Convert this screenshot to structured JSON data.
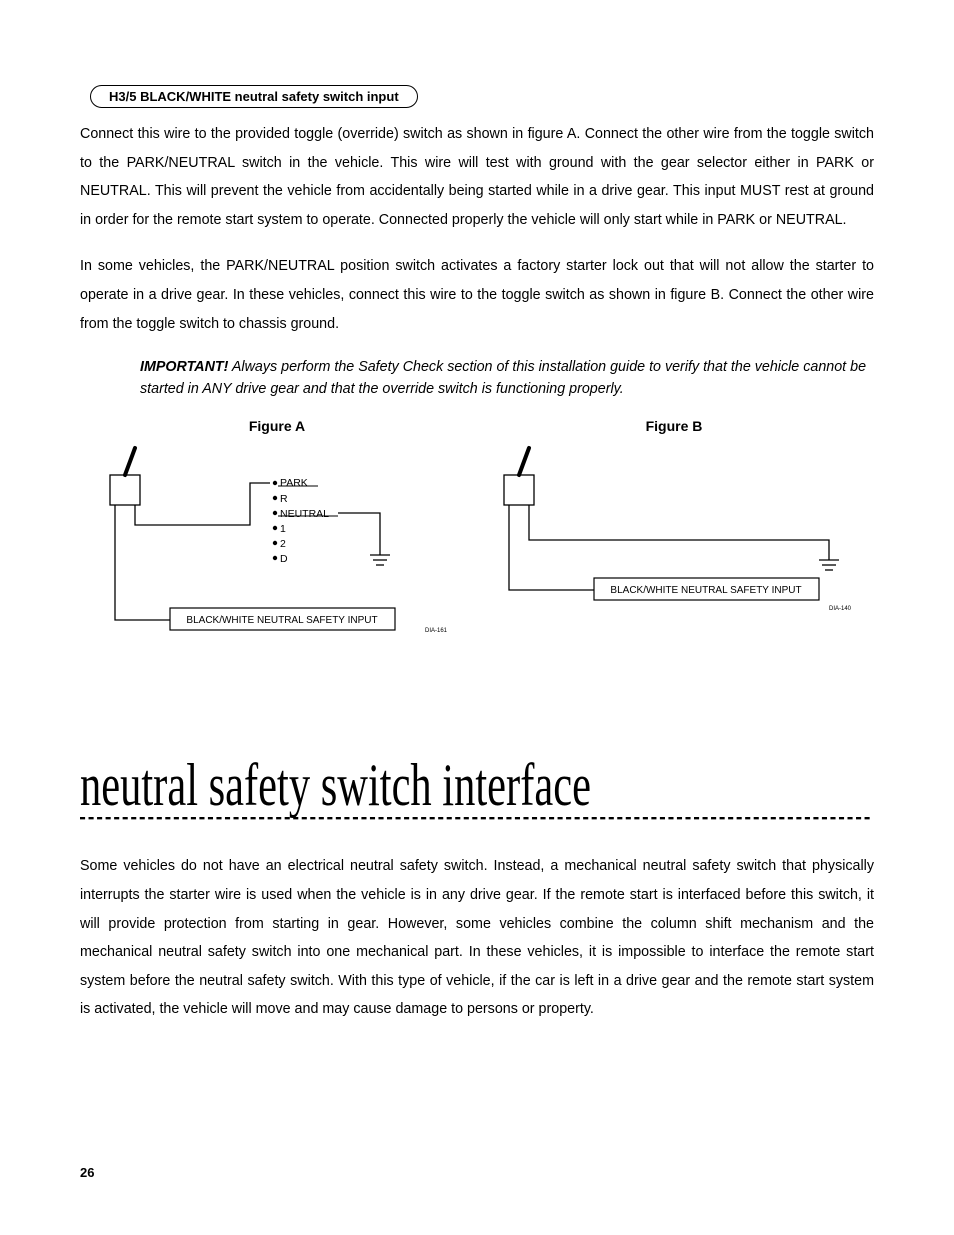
{
  "badge": "H3/5 BLACK/WHITE neutral safety switch input",
  "para1": "Connect this wire to the provided toggle (override) switch as shown in figure A. Connect the other wire from the toggle switch to the PARK/NEUTRAL switch in the vehicle. This wire will test with ground with the gear selector either in PARK or NEUTRAL. This will prevent the vehicle from accidentally being started while in a drive gear. This input MUST rest at ground in order for the remote start system to operate. Connected properly the vehicle will only start while in PARK or NEUTRAL.",
  "para2": "In some vehicles, the PARK/NEUTRAL position switch activates a factory starter lock out that will not allow the starter to operate in a drive gear. In these vehicles, connect this wire to the toggle switch as shown in figure B. Connect the other wire from the toggle switch to chassis ground.",
  "important_label": "IMPORTANT!",
  "important_text": " Always perform the Safety Check section of this installation guide to verify that the vehicle cannot be started in ANY drive gear and that the override switch is functioning properly.",
  "figA_title": "Figure A",
  "figB_title": "Figure B",
  "figA": {
    "gears": [
      "PARK",
      "R",
      "NEUTRAL",
      "1",
      "2",
      "D"
    ],
    "box_label": "BLACK/WHITE NEUTRAL SAFETY INPUT",
    "dia": "DIA-161"
  },
  "figB": {
    "box_label": "BLACK/WHITE NEUTRAL SAFETY INPUT",
    "dia": "DIA-140"
  },
  "section_title": "neutral safety switch interface",
  "para3": "Some vehicles do not have an electrical neutral safety switch. Instead, a mechanical neutral safety switch that physically interrupts the starter wire is used when the vehicle is in any drive gear. If the remote start is interfaced before this switch, it will provide protection from starting in gear. However, some vehicles combine the column shift mechanism and the mechanical neutral safety switch into one mechanical part. In these vehicles, it is impossible to interface the remote start system before the neutral safety switch. With this type of vehicle, if the car is left in a drive gear and the remote start system is activated, the vehicle will move and may cause damage to persons or property.",
  "page_number": "26"
}
